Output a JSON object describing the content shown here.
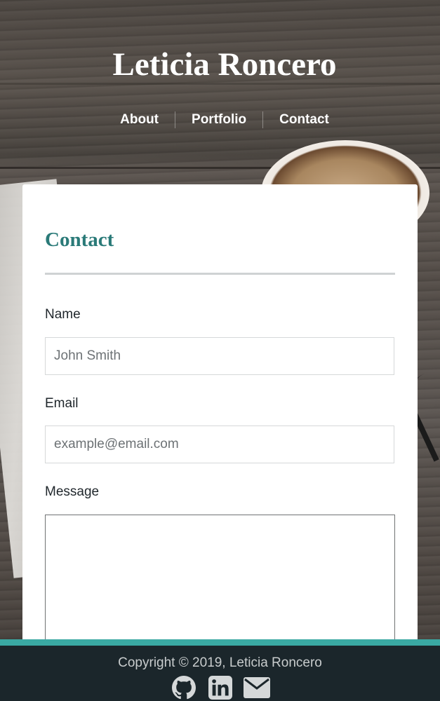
{
  "site": {
    "title": "Leticia Roncero"
  },
  "nav": {
    "items": [
      {
        "label": "About"
      },
      {
        "label": "Portfolio"
      },
      {
        "label": "Contact"
      }
    ]
  },
  "contact": {
    "heading": "Contact",
    "name_label": "Name",
    "name_placeholder": "John Smith",
    "email_label": "Email",
    "email_placeholder": "example@email.com",
    "message_label": "Message",
    "message_value": ""
  },
  "footer": {
    "copyright": "Copyright © 2019, Leticia Roncero",
    "icons": [
      "github-icon",
      "linkedin-icon",
      "envelope-icon"
    ]
  },
  "colors": {
    "accent": "#2a7a78",
    "footer_bg": "#1b262b",
    "footer_border": "#3aa9a3",
    "card_bg": "#ffffff"
  }
}
